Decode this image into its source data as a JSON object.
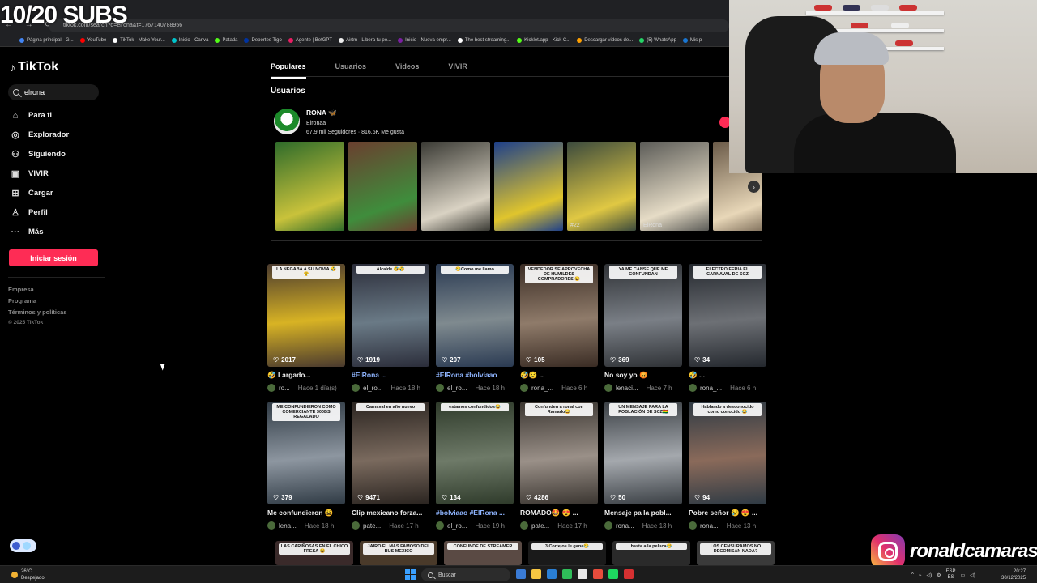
{
  "overlay": {
    "subs": "10/20 SUBS",
    "instagram_handle": "ronaldcamaras"
  },
  "browser": {
    "url": "tiktok.com/search?q=elrona&t=1767140788956",
    "bookmarks": [
      {
        "label": "Página principal - G...",
        "color": "#4285f4"
      },
      {
        "label": "YouTube",
        "color": "#ff0000"
      },
      {
        "label": "TikTok - Make Your...",
        "color": "#ffffff"
      },
      {
        "label": "Inicio - Canva",
        "color": "#00c4cc"
      },
      {
        "label": "Patada",
        "color": "#53fc18"
      },
      {
        "label": "Deportes Tigo",
        "color": "#0033a0"
      },
      {
        "label": "Agente | BetGPT",
        "color": "#e91e63"
      },
      {
        "label": "Airtm - Libera tu po...",
        "color": "#eeeeee"
      },
      {
        "label": "Inicio - Nueva empr...",
        "color": "#7b1fa2"
      },
      {
        "label": "The best streaming...",
        "color": "#ffffff"
      },
      {
        "label": "Kicklet.app - Kick C...",
        "color": "#53fc18"
      },
      {
        "label": "Descargar videos de...",
        "color": "#ffa000"
      },
      {
        "label": "(5) WhatsApp",
        "color": "#25d366"
      },
      {
        "label": "Mis p",
        "color": "#1976d2"
      }
    ]
  },
  "sidebar": {
    "logo": "TikTok",
    "search_value": "elrona",
    "items": [
      {
        "label": "Para ti",
        "icon": "⌂"
      },
      {
        "label": "Explorador",
        "icon": "◎"
      },
      {
        "label": "Siguiendo",
        "icon": "⚇"
      },
      {
        "label": "VIVIR",
        "icon": "▣"
      },
      {
        "label": "Cargar",
        "icon": "⊞"
      },
      {
        "label": "Perfil",
        "icon": "♙"
      },
      {
        "label": "Más",
        "icon": "···"
      }
    ],
    "login_label": "Iniciar sesión",
    "footer": [
      "Empresa",
      "Programa",
      "Términos y políticas"
    ],
    "copyright": "© 2025 TikTok"
  },
  "tabs": [
    {
      "label": "Populares",
      "active": true
    },
    {
      "label": "Usuarios",
      "active": false
    },
    {
      "label": "Videos",
      "active": false
    },
    {
      "label": "VIVIR",
      "active": false
    }
  ],
  "users_section": {
    "title": "Usuarios",
    "name": "RONA 🦋",
    "handle": "Elronaa",
    "stats": "67.9 mil Seguidores · 816.6K Me gusta",
    "strip": [
      {
        "colors": [
          "#2e6b2a",
          "#c9c23b"
        ],
        "caption": ""
      },
      {
        "colors": [
          "#6a3f2f",
          "#3f8d3c"
        ],
        "caption": ""
      },
      {
        "colors": [
          "#3a3a34",
          "#d9d2c3"
        ],
        "caption": ""
      },
      {
        "colors": [
          "#1d3f8a",
          "#e0c52d"
        ],
        "caption": ""
      },
      {
        "colors": [
          "#3b4a3d",
          "#e0c843"
        ],
        "caption": "#22"
      },
      {
        "colors": [
          "#5b5b57",
          "#e6dcc6"
        ],
        "caption": "ElRona"
      },
      {
        "colors": [
          "#6a5a48",
          "#e8d7b8"
        ],
        "caption": ""
      }
    ]
  },
  "videos": [
    {
      "banner": "LA NEGABA A SU NOVIA 🤣😤",
      "likes": "2017",
      "desc": "🤣 Largado...",
      "tag": false,
      "author": "ro...",
      "time": "Hace 1 día(s)",
      "colors": [
        "#4a3a2e",
        "#d8b324"
      ]
    },
    {
      "banner": "Alcalde 🤣🤣",
      "likes": "1919",
      "desc": "#ElRona ...",
      "tag": true,
      "author": "el_ro...",
      "time": "Hace 18 h",
      "colors": [
        "#2b2d3a",
        "#6a7a86"
      ]
    },
    {
      "banner": "😂Como me llamo",
      "likes": "207",
      "desc": "#ElRona #bolviaao",
      "tag": true,
      "author": "el_ro...",
      "time": "Hace 18 h",
      "colors": [
        "#2a3a52",
        "#7f8a8f"
      ]
    },
    {
      "banner": "VENDEDOR SE APROVECHA DE HUMILDES COMPRADORES 😂",
      "likes": "105",
      "desc": "🤣😢 ...",
      "tag": false,
      "author": "rona_...",
      "time": "Hace 6 h",
      "colors": [
        "#3a2c24",
        "#8f7b6a"
      ]
    },
    {
      "banner": "YA ME CANSE QUE ME CONFUNDAN",
      "likes": "369",
      "desc": "No soy yo 😡",
      "tag": false,
      "author": "lenaci...",
      "time": "Hace 7 h",
      "colors": [
        "#2f3236",
        "#7a7f86"
      ]
    },
    {
      "banner": "ELECTRO FERIA EL CARNAVAL DE SCZ",
      "likes": "34",
      "desc": "🤣 ...",
      "tag": false,
      "author": "rona_...",
      "time": "Hace 6 h",
      "colors": [
        "#24282e",
        "#6d7075"
      ]
    },
    {
      "banner": "ME CONFUNDIERON COMO COMERCIANTE 300BS REGALADO",
      "likes": "379",
      "desc": "Me confundieron 😩",
      "tag": false,
      "author": "lena...",
      "time": "Hace 18 h",
      "colors": [
        "#2f3a44",
        "#8d96a0"
      ]
    },
    {
      "banner": "Carnaval en año nuevo",
      "likes": "9471",
      "desc": "Clip mexicano forza...",
      "tag": false,
      "author": "pate...",
      "time": "Hace 17 h",
      "colors": [
        "#2a2420",
        "#7a6a5e"
      ]
    },
    {
      "banner": "estamos confundidos😂",
      "likes": "134",
      "desc": "#bolviaao #ElRona ...",
      "tag": true,
      "author": "el_ro...",
      "time": "Hace 19 h",
      "colors": [
        "#2e3a2a",
        "#6e7a68"
      ]
    },
    {
      "banner": "Confunden a ronal con Ramado😂",
      "likes": "4286",
      "desc": "ROMADO🤩 😍 ...",
      "tag": false,
      "author": "pate...",
      "time": "Hace 17 h",
      "colors": [
        "#3a3530",
        "#9a9088"
      ]
    },
    {
      "banner": "UN MENSAJE PARA LA POBLACIÓN DE SCZ🇧🇴",
      "likes": "50",
      "desc": "Mensaje pa la pobl...",
      "tag": false,
      "author": "rona...",
      "time": "Hace 13 h",
      "colors": [
        "#3a3f44",
        "#a4a8ad"
      ]
    },
    {
      "banner": "Hablando a desconocido como conocido 😂",
      "likes": "94",
      "desc": "Pobre señor 😢 😍 ...",
      "tag": false,
      "author": "rona...",
      "time": "Hace 13 h",
      "colors": [
        "#2e3a44",
        "#8a6a5a"
      ]
    }
  ],
  "row3": [
    {
      "label": "LAS CARIÑOSAS EN EL CHICO FRESA 😂",
      "color": "#3a2a2a"
    },
    {
      "label": "JAIRO EL MAS FAMOSO DEL BUS MEXICO",
      "color": "#4a3a2a"
    },
    {
      "label": "CONFUNDE DE STREAMER",
      "color": "#5a4a44"
    },
    {
      "label": "3 Cortejos le gana😂",
      "color": "#1a1a1a"
    },
    {
      "label": "hasta a la peluca😂",
      "color": "#2a2a2a"
    },
    {
      "label": "LOS CENSURAMOS NO DECOMISAN NADA?",
      "color": "#3a3a3a"
    }
  ],
  "taskbar": {
    "temp": "26°C",
    "weather": "Despejado",
    "search": "Buscar",
    "lang": "ESP",
    "lang2": "ES",
    "time": "20:27",
    "date": "30/12/2025",
    "apps": [
      "#3a7bd5",
      "#f5c542",
      "#2a7fd4",
      "#2fbd59",
      "#e8e8e8",
      "#e74c3c",
      "#1ed760",
      "#d63031"
    ]
  }
}
